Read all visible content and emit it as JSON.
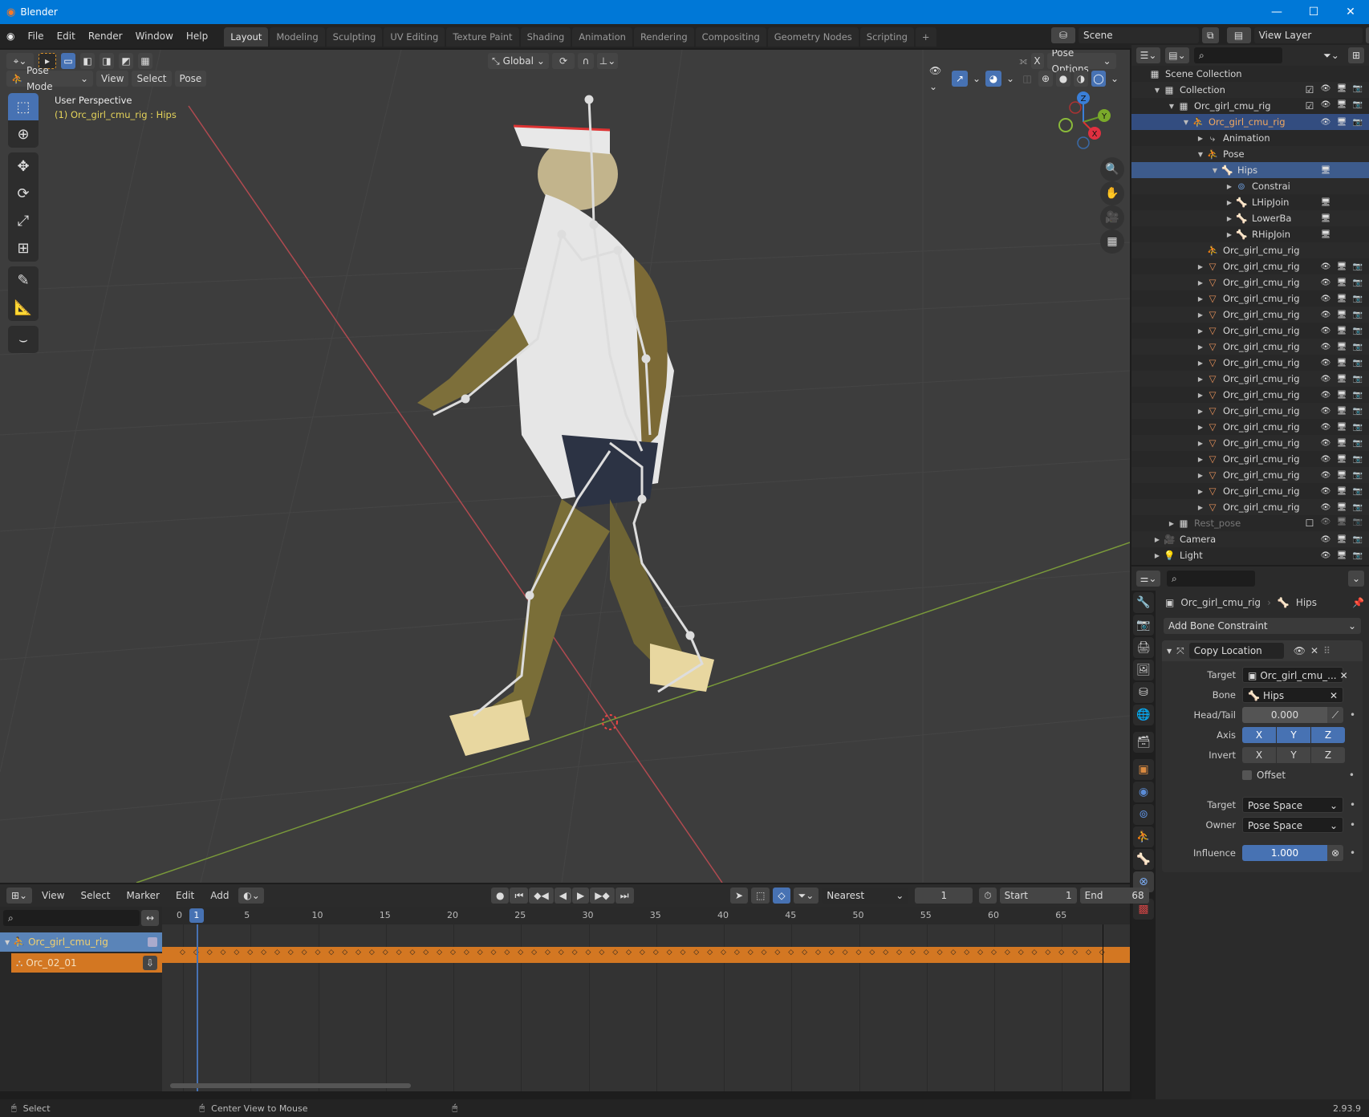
{
  "window": {
    "title": "Blender",
    "controls": [
      "minimize",
      "maximize",
      "close"
    ]
  },
  "menu": [
    "File",
    "Edit",
    "Render",
    "Window",
    "Help"
  ],
  "workspaces": [
    {
      "label": "Layout",
      "active": true
    },
    {
      "label": "Modeling"
    },
    {
      "label": "Sculpting"
    },
    {
      "label": "UV Editing"
    },
    {
      "label": "Texture Paint"
    },
    {
      "label": "Shading"
    },
    {
      "label": "Animation"
    },
    {
      "label": "Rendering"
    },
    {
      "label": "Compositing"
    },
    {
      "label": "Geometry Nodes"
    },
    {
      "label": "Scripting"
    }
  ],
  "scene": {
    "name": "Scene",
    "view_layer": "View Layer"
  },
  "viewport": {
    "mode": "Pose Mode",
    "menus": [
      "View",
      "Select",
      "Pose"
    ],
    "orientation": "Global",
    "pose_options": "Pose Options",
    "perspective": "User Perspective",
    "active": "(1) Orc_girl_cmu_rig : Hips",
    "gizmo_axes": [
      "X",
      "Y",
      "Z"
    ]
  },
  "outliner": {
    "search_placeholder": "",
    "rows": [
      {
        "label": "Scene Collection",
        "depth": 0,
        "icon": "collection-icon"
      },
      {
        "label": "Collection",
        "depth": 1,
        "icon": "collection-icon",
        "check": true,
        "vis": true
      },
      {
        "label": "Orc_girl_cmu_rig",
        "depth": 2,
        "icon": "collection-icon",
        "check": true,
        "vis": true
      },
      {
        "label": "Orc_girl_cmu_rig",
        "depth": 3,
        "icon": "armature-icon",
        "vis": true,
        "selected": true
      },
      {
        "label": "Animation",
        "depth": 4,
        "icon": "animation-icon"
      },
      {
        "label": "Pose",
        "depth": 4,
        "icon": "pose-icon"
      },
      {
        "label": "Hips",
        "depth": 5,
        "icon": "bone-icon",
        "highlight": true,
        "monitor": true
      },
      {
        "label": "Constrai",
        "depth": 6,
        "icon": "constraint-icon"
      },
      {
        "label": "LHipJoin",
        "depth": 6,
        "icon": "bone-icon",
        "monitor": true
      },
      {
        "label": "LowerBa",
        "depth": 6,
        "icon": "bone-icon",
        "monitor": true
      },
      {
        "label": "RHipJoin",
        "depth": 6,
        "icon": "bone-icon",
        "monitor": true
      },
      {
        "label": "Orc_girl_cmu_rig",
        "depth": 4,
        "icon": "armature-data-icon",
        "notri": true
      },
      {
        "label": "Orc_girl_cmu_rig",
        "depth": 4,
        "icon": "mesh-icon",
        "vis": true
      },
      {
        "label": "Orc_girl_cmu_rig",
        "depth": 4,
        "icon": "mesh-icon",
        "vis": true
      },
      {
        "label": "Orc_girl_cmu_rig",
        "depth": 4,
        "icon": "mesh-icon",
        "vis": true
      },
      {
        "label": "Orc_girl_cmu_rig",
        "depth": 4,
        "icon": "mesh-icon",
        "vis": true
      },
      {
        "label": "Orc_girl_cmu_rig",
        "depth": 4,
        "icon": "mesh-icon",
        "vis": true
      },
      {
        "label": "Orc_girl_cmu_rig",
        "depth": 4,
        "icon": "mesh-icon",
        "vis": true
      },
      {
        "label": "Orc_girl_cmu_rig",
        "depth": 4,
        "icon": "mesh-icon",
        "vis": true
      },
      {
        "label": "Orc_girl_cmu_rig",
        "depth": 4,
        "icon": "mesh-icon",
        "vis": true
      },
      {
        "label": "Orc_girl_cmu_rig",
        "depth": 4,
        "icon": "mesh-icon",
        "vis": true
      },
      {
        "label": "Orc_girl_cmu_rig",
        "depth": 4,
        "icon": "mesh-icon",
        "vis": true
      },
      {
        "label": "Orc_girl_cmu_rig",
        "depth": 4,
        "icon": "mesh-icon",
        "vis": true
      },
      {
        "label": "Orc_girl_cmu_rig",
        "depth": 4,
        "icon": "mesh-icon",
        "vis": true
      },
      {
        "label": "Orc_girl_cmu_rig",
        "depth": 4,
        "icon": "mesh-icon",
        "vis": true
      },
      {
        "label": "Orc_girl_cmu_rig",
        "depth": 4,
        "icon": "mesh-icon",
        "vis": true
      },
      {
        "label": "Orc_girl_cmu_rig",
        "depth": 4,
        "icon": "mesh-icon",
        "vis": true
      },
      {
        "label": "Orc_girl_cmu_rig",
        "depth": 4,
        "icon": "mesh-icon",
        "vis": true
      },
      {
        "label": "Rest_pose",
        "depth": 2,
        "icon": "collection-icon",
        "dim": true,
        "check": false,
        "vis": true
      },
      {
        "label": "Camera",
        "depth": 1,
        "icon": "camera-icon",
        "vis": true
      },
      {
        "label": "Light",
        "depth": 1,
        "icon": "light-icon",
        "vis": true
      }
    ]
  },
  "properties": {
    "breadcrumb": [
      "Orc_girl_cmu_rig",
      "Hips"
    ],
    "add_constraint": "Add Bone Constraint",
    "constraint": {
      "name": "Copy Location",
      "target_label": "Target",
      "target": "Orc_girl_cmu_...",
      "bone_label": "Bone",
      "bone": "Hips",
      "headtail_label": "Head/Tail",
      "headtail": "0.000",
      "axis_label": "Axis",
      "axis": [
        "X",
        "Y",
        "Z"
      ],
      "invert_label": "Invert",
      "invert": [
        "X",
        "Y",
        "Z"
      ],
      "offset_label": "Offset",
      "target_space_label": "Target",
      "target_space": "Pose Space",
      "owner_space_label": "Owner",
      "owner_space": "Pose Space",
      "influence_label": "Influence",
      "influence": "1.000"
    }
  },
  "timeline": {
    "menus": [
      "View",
      "Select",
      "Marker",
      "Edit",
      "Add"
    ],
    "snap": "Nearest Frame",
    "current_frame": "1",
    "start_label": "Start",
    "start": "1",
    "end_label": "End",
    "end": "68",
    "ticks": [
      "0",
      "5",
      "10",
      "15",
      "20",
      "25",
      "30",
      "35",
      "40",
      "45",
      "50",
      "55",
      "60",
      "65"
    ],
    "playhead": "1",
    "channels": [
      {
        "label": "Orc_girl_cmu_rig"
      },
      {
        "label": "Orc_02_01"
      }
    ]
  },
  "status": {
    "left": "Select",
    "middle": "Center View to Mouse",
    "version": "2.93.9"
  }
}
